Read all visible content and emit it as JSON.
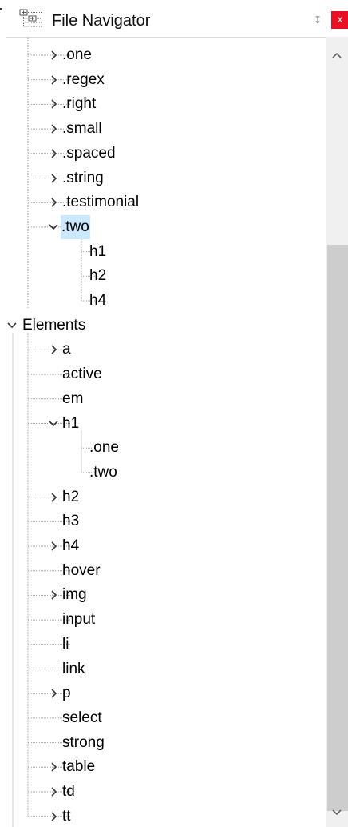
{
  "panel": {
    "title": "File Navigator",
    "pin_glyph": "↧",
    "close_glyph": "x",
    "icons": {
      "title": "tree-view-icon",
      "pin": "pin-icon",
      "close": "close-icon"
    },
    "accent": "#e81123",
    "selection_color": "#cce8ff"
  },
  "tree": {
    "rows": [
      {
        "label": ".one",
        "depth": 1,
        "type": "collapsed"
      },
      {
        "label": ".regex",
        "depth": 1,
        "type": "collapsed"
      },
      {
        "label": ".right",
        "depth": 1,
        "type": "collapsed"
      },
      {
        "label": ".small",
        "depth": 1,
        "type": "collapsed"
      },
      {
        "label": ".spaced",
        "depth": 1,
        "type": "collapsed"
      },
      {
        "label": ".string",
        "depth": 1,
        "type": "collapsed"
      },
      {
        "label": ".testimonial",
        "depth": 1,
        "type": "collapsed"
      },
      {
        "label": ".two",
        "depth": 1,
        "type": "expanded",
        "selected": true
      },
      {
        "label": "h1",
        "depth": 2,
        "type": "leaf"
      },
      {
        "label": "h2",
        "depth": 2,
        "type": "leaf"
      },
      {
        "label": "h4",
        "depth": 2,
        "type": "leaf"
      },
      {
        "label": "Elements",
        "depth": 0,
        "type": "expanded"
      },
      {
        "label": "a",
        "depth": 1,
        "type": "collapsed"
      },
      {
        "label": "active",
        "depth": 1,
        "type": "leaf"
      },
      {
        "label": "em",
        "depth": 1,
        "type": "leaf"
      },
      {
        "label": "h1",
        "depth": 1,
        "type": "expanded"
      },
      {
        "label": ".one",
        "depth": 2,
        "type": "leaf"
      },
      {
        "label": ".two",
        "depth": 2,
        "type": "leaf"
      },
      {
        "label": "h2",
        "depth": 1,
        "type": "collapsed"
      },
      {
        "label": "h3",
        "depth": 1,
        "type": "leaf"
      },
      {
        "label": "h4",
        "depth": 1,
        "type": "collapsed"
      },
      {
        "label": "hover",
        "depth": 1,
        "type": "leaf"
      },
      {
        "label": "img",
        "depth": 1,
        "type": "collapsed"
      },
      {
        "label": "input",
        "depth": 1,
        "type": "leaf"
      },
      {
        "label": "li",
        "depth": 1,
        "type": "leaf"
      },
      {
        "label": "link",
        "depth": 1,
        "type": "leaf"
      },
      {
        "label": "p",
        "depth": 1,
        "type": "collapsed"
      },
      {
        "label": "select",
        "depth": 1,
        "type": "leaf"
      },
      {
        "label": "strong",
        "depth": 1,
        "type": "leaf"
      },
      {
        "label": "table",
        "depth": 1,
        "type": "collapsed"
      },
      {
        "label": "td",
        "depth": 1,
        "type": "collapsed"
      },
      {
        "label": "tt",
        "depth": 1,
        "type": "collapsed"
      }
    ]
  },
  "scrollbar": {
    "thumb_position": 0.27,
    "thumb_size": 0.72,
    "icons": {
      "up": "chevron-up-icon",
      "down": "chevron-down-icon"
    }
  }
}
